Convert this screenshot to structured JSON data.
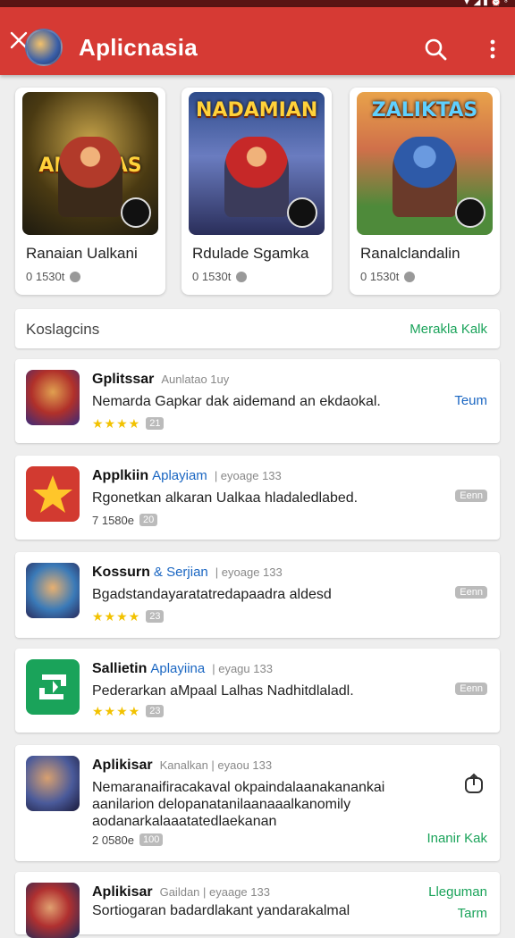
{
  "status_bar": {
    "icons": "▼ ◢ ▮ ⏰ ⁸"
  },
  "app_bar": {
    "title": "Aplicnasia"
  },
  "featured": [
    {
      "art_title": "ALLISTAS",
      "name": "Ranaian Ualkani",
      "meta": "0 1530t"
    },
    {
      "art_title": "NADAMIAN",
      "name": "Rdulade Sgamka",
      "meta": "0 1530t"
    },
    {
      "art_title": "ZALIKTAS",
      "name": "Ranalclandalin",
      "meta": "0 1530t"
    }
  ],
  "section": {
    "label": "Koslagcins",
    "more": "Merakla Kalk"
  },
  "items": [
    {
      "title": "Gplitssar",
      "sub": "Aunlatao 1uy",
      "desc": "Nemarda Gapkar dak aidemand an ekdaokal.",
      "rating": "★★★★",
      "chip": "21",
      "action": "Teum"
    },
    {
      "title": "Applkiin",
      "tag": "Aplayiam",
      "sub": "| eyoage 133",
      "desc": "Rgonetkan alkaran Ualkaa hladaledlabed.",
      "count": "7 1580e",
      "chip": "20",
      "action": "Eenn"
    },
    {
      "title": "Kossurn",
      "tag": "& Serjian",
      "sub": "| eyoage 133",
      "desc": "Bgadstandayaratatredapaadra aldesd",
      "rating": "★★★★",
      "chip": "23",
      "action": "Eenn"
    },
    {
      "title": "Sallietin",
      "tag": "Aplayiina",
      "sub": "| eyagu 133",
      "desc": "Pederarkan aMpaal Lalhas Nadhitdlaladl.",
      "rating": "★★★★",
      "chip": "23",
      "action": "Eenn"
    },
    {
      "title": "Aplikisar",
      "sub": "Kanalkan | eyaou 133",
      "desc": "Nemaranaifiracakaval okpaindalaanakanankai aanilarion delopanatanilaanaaalkanomily aodanarkalaaatatedlaekanan",
      "count": "2 0580e",
      "chip": "100",
      "action": "Inanir Kak"
    },
    {
      "title": "Aplikisar",
      "sub": "Gaildan | eyaage 133",
      "desc": "Sortiogaran badardlakant yandarakalmal",
      "action": "Lleguman",
      "action2": "Tarm"
    }
  ]
}
